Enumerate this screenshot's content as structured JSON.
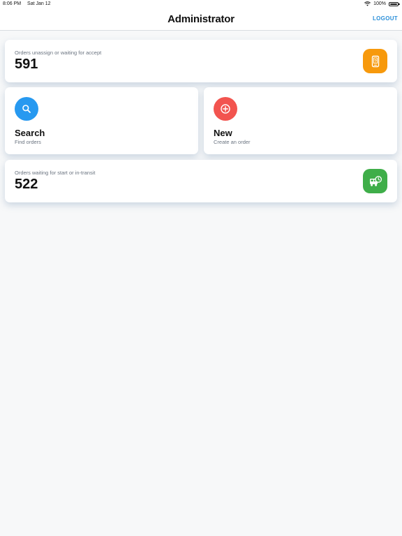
{
  "status_bar": {
    "time": "8:06 PM",
    "date": "Sat Jan 12",
    "battery": "100%"
  },
  "nav": {
    "title": "Administrator",
    "logout_label": "LOGOUT"
  },
  "stats": [
    {
      "label": "Orders unassign or waiting for accept",
      "value": "591",
      "icon": "phone-question-icon",
      "color": "#f7990c"
    },
    {
      "label": "Orders waiting for start or in-transit",
      "value": "522",
      "icon": "truck-clock-icon",
      "color": "#3fae49"
    }
  ],
  "actions": [
    {
      "title": "Search",
      "subtitle": "Find orders",
      "icon": "search-icon",
      "color": "#2799f0"
    },
    {
      "title": "New",
      "subtitle": "Create an order",
      "icon": "add-circle-icon",
      "color": "#f2544f"
    }
  ],
  "colors": {
    "accent": "#2a8fd9",
    "background": "#f7f8f9"
  }
}
